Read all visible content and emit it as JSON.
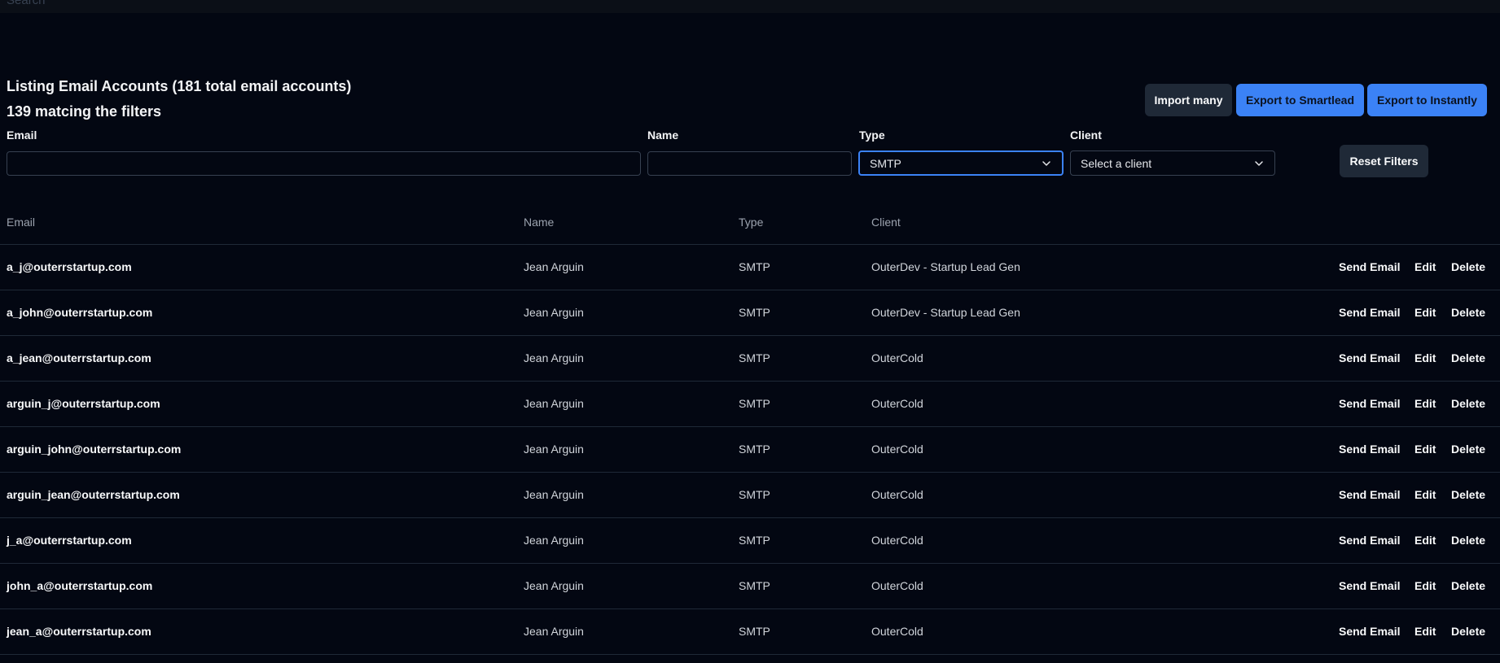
{
  "topbar": {
    "search_placeholder": "Search"
  },
  "header": {
    "title": "Listing Email Accounts (181 total email accounts)",
    "matching": "139 matcing the filters"
  },
  "actions": {
    "import_label": "Import many",
    "export_smartlead_label": "Export to Smartlead",
    "export_instantly_label": "Export to Instantly",
    "reset_label": "Reset Filters"
  },
  "filters": {
    "email_label": "Email",
    "email_value": "",
    "name_label": "Name",
    "name_value": "",
    "type_label": "Type",
    "type_value": "SMTP",
    "client_label": "Client",
    "client_value": "Select a client"
  },
  "table": {
    "columns": [
      "Email",
      "Name",
      "Type",
      "Client"
    ],
    "action_labels": {
      "send": "Send Email",
      "edit": "Edit",
      "delete": "Delete"
    },
    "rows": [
      {
        "email": "a_j@outerrstartup.com",
        "name": "Jean Arguin",
        "type": "SMTP",
        "client": "OuterDev - Startup Lead Gen"
      },
      {
        "email": "a_john@outerrstartup.com",
        "name": "Jean Arguin",
        "type": "SMTP",
        "client": "OuterDev - Startup Lead Gen"
      },
      {
        "email": "a_jean@outerrstartup.com",
        "name": "Jean Arguin",
        "type": "SMTP",
        "client": "OuterCold"
      },
      {
        "email": "arguin_j@outerrstartup.com",
        "name": "Jean Arguin",
        "type": "SMTP",
        "client": "OuterCold"
      },
      {
        "email": "arguin_john@outerrstartup.com",
        "name": "Jean Arguin",
        "type": "SMTP",
        "client": "OuterCold"
      },
      {
        "email": "arguin_jean@outerrstartup.com",
        "name": "Jean Arguin",
        "type": "SMTP",
        "client": "OuterCold"
      },
      {
        "email": "j_a@outerrstartup.com",
        "name": "Jean Arguin",
        "type": "SMTP",
        "client": "OuterCold"
      },
      {
        "email": "john_a@outerrstartup.com",
        "name": "Jean Arguin",
        "type": "SMTP",
        "client": "OuterCold"
      },
      {
        "email": "jean_a@outerrstartup.com",
        "name": "Jean Arguin",
        "type": "SMTP",
        "client": "OuterCold"
      }
    ]
  },
  "colors": {
    "background": "#030712",
    "accent": "#3b82f6",
    "button_dark": "#1f2937"
  }
}
